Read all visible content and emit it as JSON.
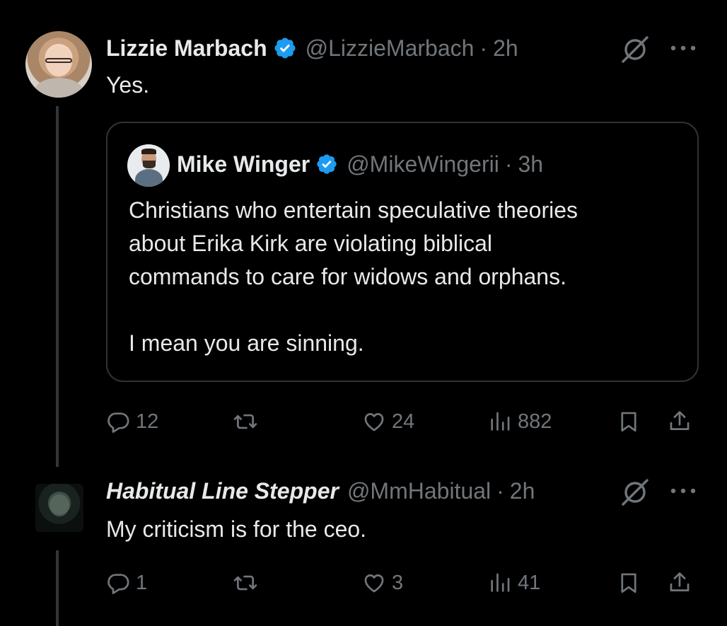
{
  "colors": {
    "background": "#000000",
    "text": "#e7e9ea",
    "muted": "#71767b",
    "verified": "#1d9bf0",
    "border": "#2f3336"
  },
  "tweets": [
    {
      "name": "Lizzie Marbach",
      "verified": true,
      "handle": "@LizzieMarbach",
      "separator": "·",
      "time": "2h",
      "text": "Yes.",
      "quote": {
        "name": "Mike Winger",
        "verified": true,
        "handle": "@MikeWingerii",
        "separator": "·",
        "time": "3h",
        "lines": [
          "Christians who entertain speculative theories",
          "about Erika Kirk are violating biblical",
          "commands to care for widows and orphans."
        ],
        "last_line": "I mean you are sinning."
      },
      "stats": {
        "replies": "12",
        "reposts": "",
        "likes": "24",
        "views": "882"
      }
    },
    {
      "name": "Habitual Line Stepper",
      "verified": false,
      "handle": "@MmHabitual",
      "separator": "·",
      "time": "2h",
      "text": "My criticism is for the ceo.",
      "stats": {
        "replies": "1",
        "reposts": "",
        "likes": "3",
        "views": "41"
      }
    }
  ],
  "icons": [
    "grok-icon",
    "more-icon",
    "verified-icon",
    "reply-icon",
    "repost-icon",
    "like-icon",
    "views-icon",
    "bookmark-icon",
    "share-icon"
  ]
}
